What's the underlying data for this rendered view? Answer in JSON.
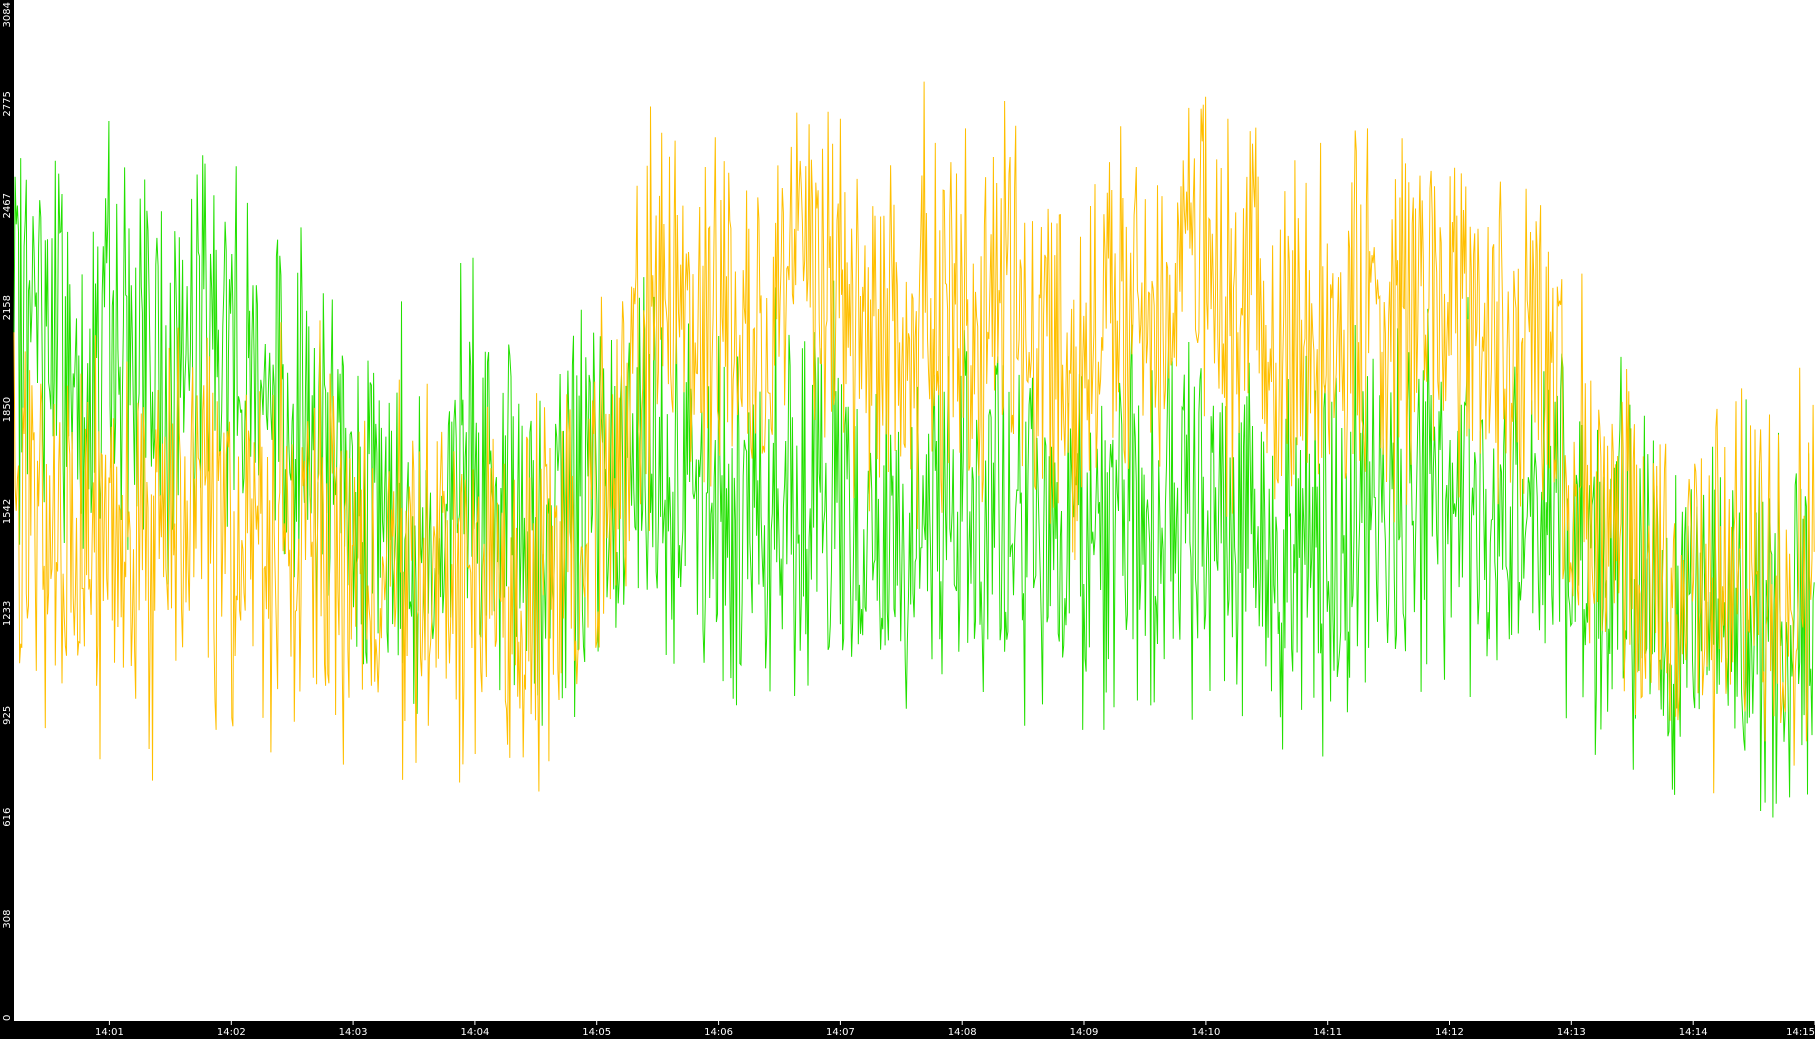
{
  "chart_data": {
    "type": "line",
    "title": "",
    "xlabel": "",
    "ylabel": "",
    "ylim": [
      0,
      3084
    ],
    "xlim": [
      "14:00:13",
      "14:15:00"
    ],
    "grid": false,
    "legend": "none",
    "y_ticks": [
      "0",
      "308",
      "616",
      "925",
      "1233",
      "1542",
      "1850",
      "2158",
      "2467",
      "2775",
      "3084"
    ],
    "x_ticks": [
      "14:01",
      "14:02",
      "14:03",
      "14:04",
      "14:05",
      "14:06",
      "14:07",
      "14:08",
      "14:09",
      "14:10",
      "14:11",
      "14:12",
      "14:13",
      "14:14",
      "14:15"
    ],
    "series": [
      {
        "color": "#22e000",
        "x": [
          "14:00:13",
          "14:00:30",
          "14:00:45",
          "14:01:00",
          "14:01:15",
          "14:01:30",
          "14:01:45",
          "14:02:00",
          "14:02:15",
          "14:02:30",
          "14:02:45",
          "14:03:00",
          "14:03:15",
          "14:03:30",
          "14:03:45",
          "14:04:00",
          "14:04:15",
          "14:04:30",
          "14:04:45",
          "14:05:00",
          "14:05:15",
          "14:05:30",
          "14:05:45",
          "14:06:00",
          "14:06:15",
          "14:06:30",
          "14:06:45",
          "14:07:00",
          "14:07:15",
          "14:07:30",
          "14:07:45",
          "14:08:00",
          "14:08:15",
          "14:08:30",
          "14:08:45",
          "14:09:00",
          "14:09:15",
          "14:09:30",
          "14:09:45",
          "14:10:00",
          "14:10:15",
          "14:10:30",
          "14:10:45",
          "14:11:00",
          "14:11:15",
          "14:11:30",
          "14:11:45",
          "14:12:00",
          "14:12:15",
          "14:12:30",
          "14:12:45",
          "14:13:00",
          "14:13:15",
          "14:13:30",
          "14:13:45",
          "14:14:00",
          "14:14:15",
          "14:14:30",
          "14:14:45",
          "14:15:00"
        ],
        "y": [
          2050,
          2150,
          1900,
          2050,
          2000,
          1950,
          2150,
          2050,
          2000,
          1850,
          1750,
          1600,
          1500,
          1450,
          1550,
          1600,
          1500,
          1450,
          1550,
          1600,
          1700,
          1650,
          1600,
          1550,
          1500,
          1600,
          1550,
          1500,
          1450,
          1400,
          1500,
          1550,
          1500,
          1450,
          1400,
          1500,
          1450,
          1500,
          1550,
          1600,
          1500,
          1400,
          1450,
          1500,
          1450,
          1550,
          1650,
          1550,
          1500,
          1550,
          1600,
          1450,
          1400,
          1350,
          1300,
          1300,
          1250,
          1200,
          1200,
          1200
        ]
      },
      {
        "color": "#ffbf00",
        "x": [
          "14:00:13",
          "14:00:30",
          "14:00:45",
          "14:01:00",
          "14:01:15",
          "14:01:30",
          "14:01:45",
          "14:02:00",
          "14:02:15",
          "14:02:30",
          "14:02:45",
          "14:03:00",
          "14:03:15",
          "14:03:30",
          "14:03:45",
          "14:04:00",
          "14:04:15",
          "14:04:30",
          "14:04:45",
          "14:05:00",
          "14:05:15",
          "14:05:30",
          "14:05:45",
          "14:06:00",
          "14:06:15",
          "14:06:30",
          "14:06:45",
          "14:07:00",
          "14:07:15",
          "14:07:30",
          "14:07:45",
          "14:08:00",
          "14:08:15",
          "14:08:30",
          "14:08:45",
          "14:09:00",
          "14:09:15",
          "14:09:30",
          "14:09:45",
          "14:10:00",
          "14:10:15",
          "14:10:30",
          "14:10:45",
          "14:11:00",
          "14:11:15",
          "14:11:30",
          "14:11:45",
          "14:12:00",
          "14:12:15",
          "14:12:30",
          "14:12:45",
          "14:13:00",
          "14:13:15",
          "14:13:30",
          "14:13:45",
          "14:14:00",
          "14:14:15",
          "14:14:30",
          "14:14:45",
          "14:15:00"
        ],
        "y": [
          1600,
          1500,
          1450,
          1400,
          1450,
          1500,
          1550,
          1500,
          1450,
          1400,
          1450,
          1400,
          1350,
          1300,
          1350,
          1250,
          1300,
          1350,
          1450,
          1550,
          1800,
          2250,
          2150,
          2200,
          2100,
          2150,
          2250,
          2200,
          2100,
          2050,
          2150,
          2100,
          2250,
          2100,
          2000,
          2050,
          2150,
          2100,
          2300,
          2250,
          2150,
          2100,
          2050,
          2100,
          2150,
          2050,
          2250,
          2150,
          2100,
          2050,
          2050,
          1700,
          1450,
          1350,
          1300,
          1350,
          1300,
          1350,
          1400,
          1350
        ]
      }
    ]
  }
}
